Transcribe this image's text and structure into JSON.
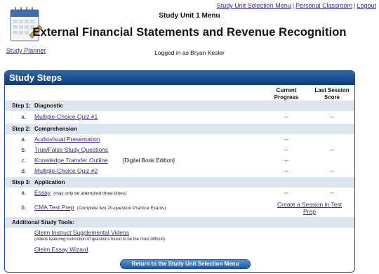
{
  "top_nav": {
    "selection_menu": "Study Unit Selection Menu",
    "personal_classroom": "Personal Classroom",
    "logout": "Logout",
    "separator": "|"
  },
  "planner": {
    "label": "Study Planner",
    "icon": "calendar-icon"
  },
  "header": {
    "unit_title": "Study Unit 1 Menu",
    "main_title": "External Financial Statements and Revenue Recognition",
    "logged_in": "Logged in as Bryan Kesler"
  },
  "panel": {
    "title": "Study Steps",
    "col_progress": "Current Progress",
    "col_score": "Last Session Score"
  },
  "steps": [
    {
      "step": "Step 1:",
      "name": "Diagnostic",
      "items": [
        {
          "letter": "a.",
          "label": "Multiple-Choice Quiz #1",
          "note": "",
          "extra": "",
          "progress": "--",
          "score": "--"
        }
      ]
    },
    {
      "step": "Step 2:",
      "name": "Comprehension",
      "items": [
        {
          "letter": "a.",
          "label": "Audiovisual Presentation",
          "note": "",
          "extra": "",
          "progress": "--",
          "score": ""
        },
        {
          "letter": "b.",
          "label": "True/False Study Questions",
          "note": "",
          "extra": "",
          "progress": "--",
          "score": "--"
        },
        {
          "letter": "c.",
          "label": "Knowledge Transfer Outline",
          "note": "",
          "extra": "[Digital Book Edition]",
          "progress": "--",
          "score": ""
        },
        {
          "letter": "d.",
          "label": "Multiple-Choice Quiz #2",
          "note": "",
          "extra": "",
          "progress": "--",
          "score": "--"
        }
      ]
    },
    {
      "step": "Step 3:",
      "name": "Application",
      "items": [
        {
          "letter": "a.",
          "label": "Essay",
          "note": "(may only be attempted three times)",
          "extra": "",
          "progress": "--",
          "score": "--"
        },
        {
          "letter": "b.",
          "label": "CMA Test Prep",
          "note": "(Complete two 20-question Practice Exams)",
          "extra": "",
          "progress": "",
          "score": "",
          "link": "Create a Session in Test Prep"
        }
      ]
    }
  ],
  "additional": {
    "title": "Additional Study Tools:",
    "videos_label": "Gleim Instruct Supplemental Videos",
    "videos_note": "(videos featuring instruction of questions found to be the most difficult)",
    "essay_wizard": "Gleim Essay Wizard"
  },
  "return_button": "Return to the Study Unit Selection Menu",
  "colors": {
    "header_blue": "#0f3c78",
    "band": "#dde5ee",
    "link": "#3a2a8c"
  }
}
